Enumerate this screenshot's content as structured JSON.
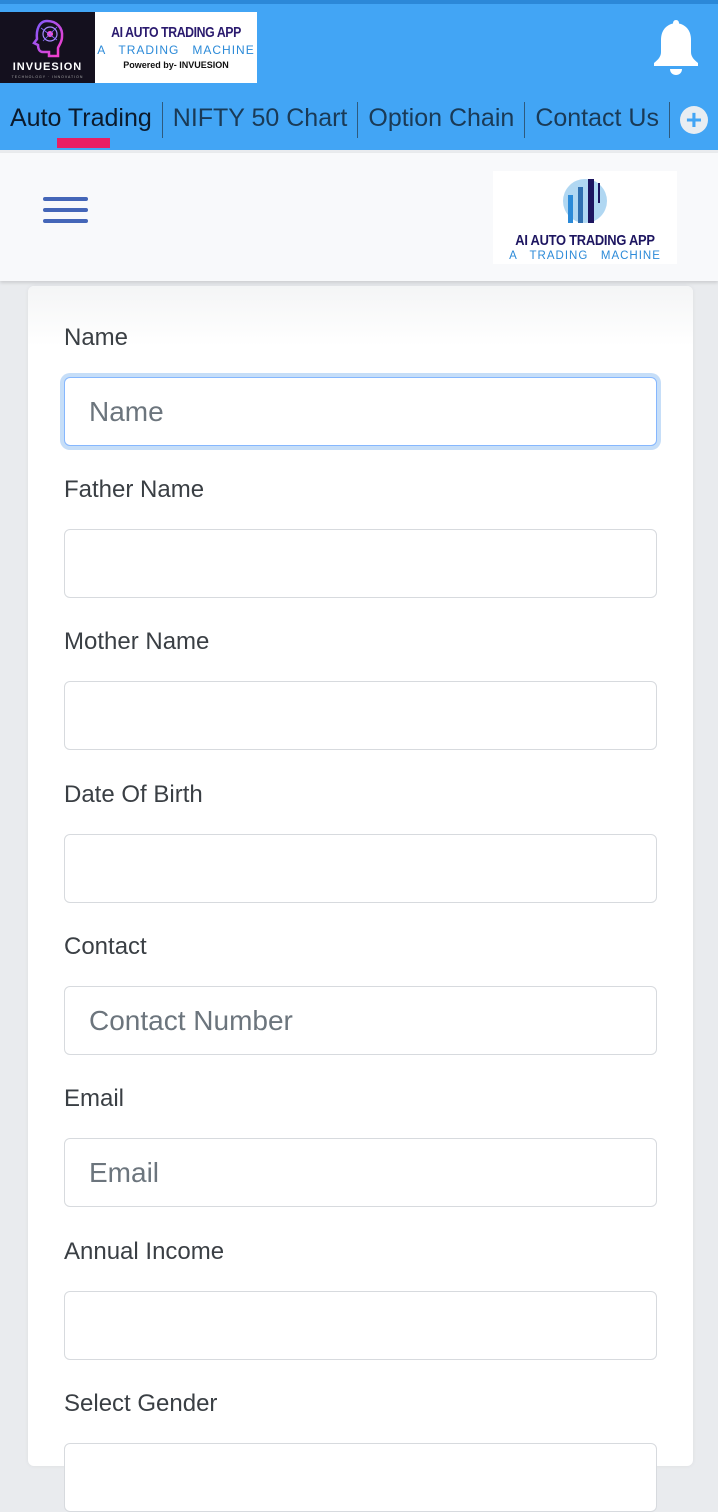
{
  "header": {
    "brand": {
      "company": "INVUESION",
      "company_tagline": "TECHNOLOGY · INNOVATION",
      "app_name": "AI AUTO TRADING APP",
      "app_tagline": "A   TRADING   MACHINE",
      "powered_by": "Powered by- INVUESION"
    },
    "notification_icon": "bell-icon"
  },
  "tabs": [
    {
      "label": "Auto Trading",
      "active": true
    },
    {
      "label": "NIFTY 50 Chart",
      "active": false
    },
    {
      "label": "Option Chain",
      "active": false
    },
    {
      "label": "Contact Us",
      "active": false
    }
  ],
  "more_tabs_icon": "plus-icon",
  "navbar": {
    "menu_icon": "hamburger-icon",
    "logo_title": "AI AUTO TRADING APP",
    "logo_subtitle": "A   TRADING   MACHINE"
  },
  "colors": {
    "header_bg": "#42a5f5",
    "active_tab_indicator": "#e91e63",
    "menu_icon": "#4466b8"
  },
  "form": {
    "fields": [
      {
        "label": "Name",
        "value": "",
        "placeholder": "Name",
        "focused": true
      },
      {
        "label": "Father Name",
        "value": "",
        "placeholder": ""
      },
      {
        "label": "Mother Name",
        "value": "",
        "placeholder": ""
      },
      {
        "label": "Date Of Birth",
        "value": "",
        "placeholder": ""
      },
      {
        "label": "Contact",
        "value": "",
        "placeholder": "Contact Number"
      },
      {
        "label": "Email",
        "value": "",
        "placeholder": "Email"
      },
      {
        "label": "Annual Income",
        "value": "",
        "placeholder": ""
      },
      {
        "label": "Select Gender",
        "value": "",
        "placeholder": ""
      }
    ]
  }
}
